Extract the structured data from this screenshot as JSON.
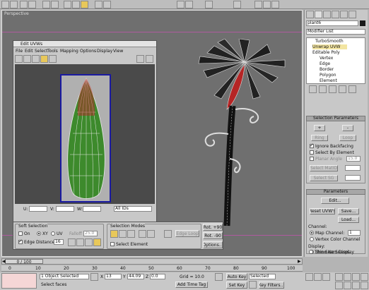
{
  "viewport": {
    "label": "Perspective"
  },
  "uvw_editor": {
    "title": "Edit UVWs",
    "menu": [
      "File",
      "Edit",
      "Select",
      "Tools",
      "Mapping",
      "Options",
      "Display",
      "View"
    ],
    "u_label": "U:",
    "v_label": "V:",
    "w_label": "W:",
    "id_select": "All IDs",
    "soft_selection": {
      "title": "Soft Selection",
      "on": "On",
      "xy": "XY",
      "uv": "UV",
      "falloff_label": "Falloff",
      "falloff_value": "25.0",
      "edge_distance": "Edge Distance",
      "edge_value": "16"
    },
    "selection_modes": {
      "title": "Selection Modes",
      "edge_loop": "Edge Loop",
      "select_element": "Select Element"
    },
    "rot_plus": "Rot. +90",
    "rot_minus": "Rot. -90",
    "options": "Options..."
  },
  "command_panel": {
    "object_name": "plant6",
    "modifier_list": "Modifier List",
    "stack": [
      "TurboSmooth",
      "Unwrap UVW",
      "Editable Poly",
      "Vertex",
      "Edge",
      "Border",
      "Polygon",
      "Element"
    ],
    "selection_parameters": {
      "title": "Selection Parameters",
      "plus": "+",
      "minus": "-",
      "ring": "Ring",
      "loop": "Loop",
      "ignore_backfacing": "Ignore Backfacing",
      "select_by_element": "Select By Element",
      "planar_angle": "Planar Angle",
      "planar_value": "15.0",
      "select_matid": "Select MatID",
      "select_sg": "Select SG"
    },
    "parameters": {
      "title": "Parameters",
      "edit": "Edit...",
      "reset_uvws": "Reset UVW's",
      "save": "Save...",
      "load": "Load...",
      "channel": "Channel:",
      "map_channel": "Map Channel:",
      "map_value": "1",
      "vertex_color_channel": "Vertex Color Channel",
      "display": "Display:",
      "show_no_seams": "Show No Seams",
      "thin_seam": "Thin Seam Display"
    }
  },
  "timeline": {
    "frame_counter": "0 / 100",
    "ticks": [
      "0",
      "10",
      "20",
      "30",
      "40",
      "50",
      "60",
      "70",
      "80",
      "90",
      "100"
    ]
  },
  "status": {
    "selected": "1 Object Selected",
    "prompt": "Select faces",
    "x_label": "X",
    "x_value": "13",
    "y_label": "Y",
    "y_value": "44.09",
    "z_label": "Z",
    "z_value": "0.0",
    "grid": "Grid = 10.0",
    "add_time_tag": "Add Time Tag",
    "auto_key": "Auto Key",
    "set_key": "Set Key",
    "selected_dropdown": "Selected",
    "key_filters": "Key Filters..."
  },
  "colors": {
    "viewport_bg": "#6f6f6f",
    "uv_bg": "#4a4a4a",
    "leaf_green": "#3d8a2c",
    "petal_red": "#b52525",
    "stack_highlight": "#f3e5a2"
  }
}
